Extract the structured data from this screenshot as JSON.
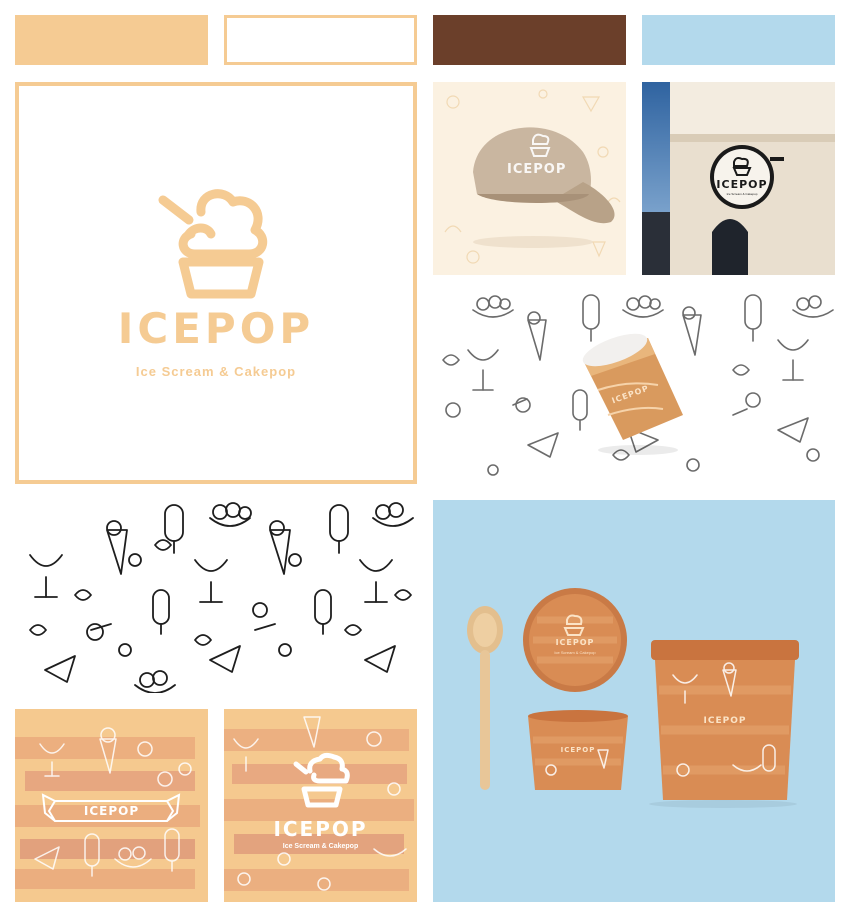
{
  "palette": {
    "swatches": [
      {
        "name": "peach",
        "hex": "#F5CB93"
      },
      {
        "name": "white",
        "hex": "#FFFFFF"
      },
      {
        "name": "brown",
        "hex": "#6B3F2A"
      },
      {
        "name": "light-blue",
        "hex": "#B3D9EC"
      }
    ],
    "accent": "#F5CB93",
    "background": "#FFFFFF"
  },
  "main_logo": {
    "brand": "ICEPOP",
    "tagline": "Ice Scream & Cakepop",
    "icon": "ice-cream-cup-icon"
  },
  "cap_mockup": {
    "brand": "ICEPOP",
    "icon": "ice-cream-cup-icon"
  },
  "sign_mockup": {
    "brand": "ICEPOP",
    "tagline": "Ice Scream & Cakepop",
    "icon": "ice-cream-cup-icon"
  },
  "cup_mockup": {
    "brand": "ICEPOP"
  },
  "banner_card": {
    "brand": "ICEPOP"
  },
  "logo_card": {
    "brand": "ICEPOP",
    "tagline": "Ice Scream & Cakepop",
    "icon": "ice-cream-cup-icon"
  },
  "packaging": {
    "lid": {
      "brand": "ICEPOP",
      "tagline": "Ice Scream & Cakepop"
    },
    "small_cup": {
      "brand": "ICEPOP"
    },
    "large_tub": {
      "brand": "ICEPOP"
    },
    "spoon_icon": "wooden-spoon-icon"
  }
}
